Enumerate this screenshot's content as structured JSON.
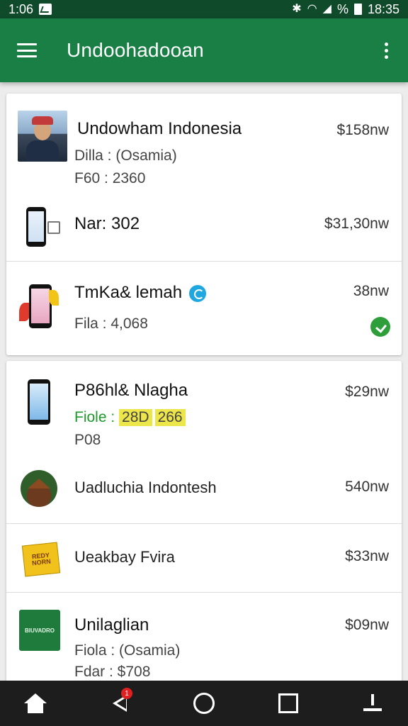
{
  "status_bar": {
    "time_left": "1:06",
    "battery_percent": "%",
    "time_right": "18:35"
  },
  "app_bar": {
    "title": "Undoohadooan"
  },
  "card1": {
    "items": [
      {
        "name": "Undowham Indonesia",
        "line1": "Dilla : (Osamia)",
        "line2": "F60  : 2360",
        "price": "$158nw"
      },
      {
        "name": "Nar: 302",
        "price": "$31,30nw"
      },
      {
        "name": "TmKa& lemah",
        "line1": "Fila  : 4,068",
        "price": "38nw"
      }
    ]
  },
  "card2": {
    "items": [
      {
        "name": "P86hl& Nlagha",
        "line1_label": "Fiole :",
        "line1_hl1": "28D",
        "line1_hl2": "266",
        "line2": "P08",
        "price": "$29nw"
      },
      {
        "name": "Uadluchia Indontesh",
        "price": "540nw"
      },
      {
        "name": "Ueakbay Fvira",
        "sticker": "REDY NORN",
        "price": "$33nw"
      },
      {
        "name": "Unilaglian",
        "logo": "BIUVADRO",
        "line1": "Fiola : (Osamia)",
        "line2": "Fdar : $708",
        "price": "$09nw"
      }
    ]
  },
  "nav_bar": {
    "back_badge": "1"
  }
}
